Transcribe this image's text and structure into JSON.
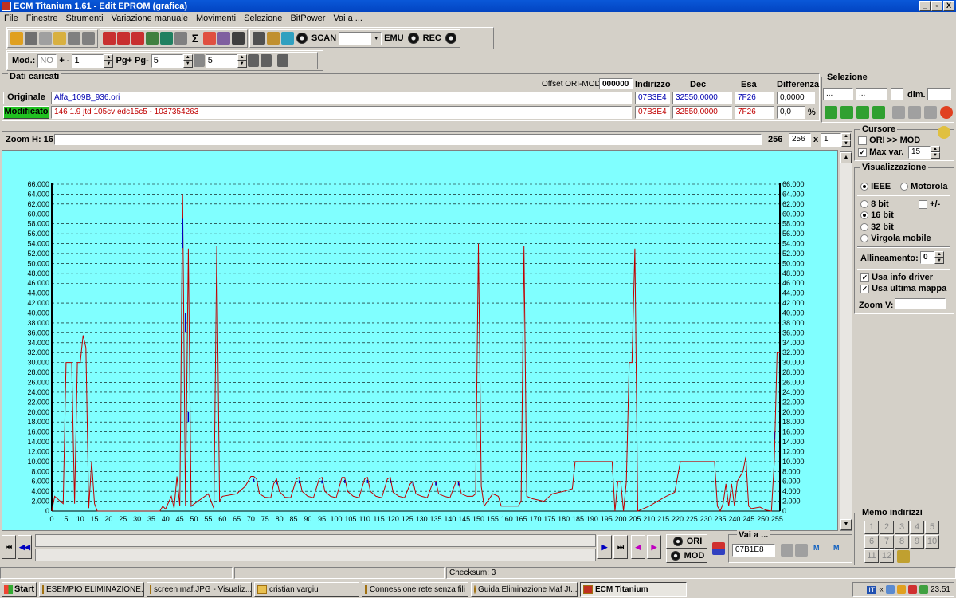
{
  "window": {
    "title": "ECM Titanium 1.61 - Edit EPROM (grafica)",
    "controls": [
      "_",
      "▫",
      "X"
    ]
  },
  "menu": [
    "File",
    "Finestre",
    "Strumenti",
    "Variazione manuale",
    "Movimenti",
    "Selezione",
    "BitPower",
    "Vai a ..."
  ],
  "toolbar": {
    "scan_label": "SCAN",
    "emu_label": "EMU",
    "rec_label": "REC",
    "mod_label": "Mod.:",
    "mod_value": "NO",
    "plusminus_label": "+ -",
    "plusminus_value": "1",
    "pg_label": "Pg+ Pg-",
    "pg_value": "5",
    "p_value": "5"
  },
  "dati": {
    "title": "Dati caricati",
    "offset_label": "Offset ORI-MOD",
    "offset_value": "000000",
    "col_indirizzo": "Indirizzo",
    "col_dec": "Dec",
    "col_esa": "Esa",
    "col_diff": "Differenza",
    "originale_label": "Originale",
    "originale_file": "Alfa_109B_936.ori",
    "originale_addr": "07B3E4",
    "originale_dec": "32550,0000",
    "originale_esa": "7F26",
    "originale_diff": "0,0000",
    "modificato_label": "Modificato",
    "modificato_file": "146 1.9 jtd 105cv edc15c5 - 1037354263",
    "modificato_addr": "07B3E4",
    "modificato_dec": "32550,0000",
    "modificato_esa": "7F26",
    "modificato_diff": "0,0",
    "percent": "%"
  },
  "selezione": {
    "title": "Selezione",
    "f1": "...",
    "f2": "...",
    "dim_label": "dim."
  },
  "zoom": {
    "label": "Zoom H: 16",
    "value_text": "256",
    "value_box": "256",
    "x_label": "x",
    "mult": "1"
  },
  "cursore": {
    "title": "Cursore",
    "ori_mod": "ORI >> MOD",
    "maxvar_label": "Max var.",
    "maxvar_value": "15"
  },
  "visualizzazione": {
    "title": "Visualizzazione",
    "ieee": "IEEE",
    "motorola": "Motorola",
    "bit8": "8 bit",
    "plusminus": "+/-",
    "bit16": "16 bit",
    "bit32": "32 bit",
    "virgola": "Virgola mobile",
    "allineamento_label": "Allineamento:",
    "allineamento_value": "0",
    "usa_info": "Usa info driver",
    "usa_ultima": "Usa ultima mappa",
    "zoomv_label": "Zoom V:"
  },
  "memo": {
    "title": "Memo indirizzi",
    "buttons": [
      "1",
      "2",
      "3",
      "4",
      "5",
      "6",
      "7",
      "8",
      "9",
      "10",
      "11",
      "12"
    ]
  },
  "bottom": {
    "ori_label": "ORI",
    "mod_label": "MOD",
    "vai_label": "Vai a ...",
    "vai_value": "07B1E8"
  },
  "status": {
    "checksum": "Checksum: 3"
  },
  "taskbar": {
    "start": "Start",
    "tasks": [
      "ESEMPIO ELIMINAZIONE...",
      "screen maf.JPG - Visualiz...",
      "cristian vargiu",
      "Connessione rete senza fili",
      "Guida Eliminazione Maf Jt...",
      "ECM Titanium"
    ],
    "clock": "23.51",
    "lang": "IT"
  },
  "colors": {
    "chart_bg": "#80ffff",
    "ori_line": "#c00000",
    "mod_line": "#0000c0",
    "grid": "#000000"
  },
  "chart_data": {
    "type": "line",
    "xlim": [
      0,
      256
    ],
    "ylim": [
      0,
      66000
    ],
    "xticks": [
      0,
      5,
      10,
      15,
      20,
      25,
      30,
      35,
      40,
      45,
      50,
      55,
      60,
      65,
      70,
      75,
      80,
      85,
      90,
      95,
      100,
      105,
      110,
      115,
      120,
      125,
      130,
      135,
      140,
      145,
      150,
      155,
      160,
      165,
      170,
      175,
      180,
      185,
      190,
      195,
      200,
      205,
      210,
      215,
      220,
      225,
      230,
      235,
      240,
      245,
      250,
      255
    ],
    "yticks": [
      "0",
      "2.000",
      "4.000",
      "6.000",
      "8.000",
      "10.000",
      "12.000",
      "14.000",
      "16.000",
      "18.000",
      "20.000",
      "22.000",
      "24.000",
      "26.000",
      "28.000",
      "30.000",
      "32.000",
      "34.000",
      "36.000",
      "38.000",
      "40.000",
      "42.000",
      "44.000",
      "46.000",
      "48.000",
      "50.000",
      "52.000",
      "54.000",
      "56.000",
      "58.000",
      "60.000",
      "62.000",
      "64.000",
      "66.000"
    ],
    "grid": true,
    "series": [
      {
        "points": [
          [
            0,
            0
          ],
          [
            1,
            3000
          ],
          [
            3,
            2000
          ],
          [
            4,
            1500
          ],
          [
            5,
            30000
          ],
          [
            7,
            30000
          ],
          [
            8,
            1500
          ],
          [
            9,
            30000
          ],
          [
            10,
            30000
          ],
          [
            11,
            35500
          ],
          [
            12,
            33000
          ],
          [
            13,
            600
          ],
          [
            14,
            10000
          ],
          [
            15,
            1500
          ],
          [
            16,
            0
          ],
          [
            38,
            0
          ],
          [
            39,
            1000
          ],
          [
            40,
            400
          ],
          [
            42,
            3000
          ],
          [
            43,
            600
          ],
          [
            44,
            7000
          ],
          [
            45,
            1000
          ],
          [
            46,
            64000
          ],
          [
            47,
            1000
          ],
          [
            48,
            53000
          ],
          [
            49,
            1000
          ],
          [
            55,
            3500
          ],
          [
            57,
            500
          ],
          [
            58,
            53500
          ],
          [
            59,
            2000
          ],
          [
            60,
            3000
          ],
          [
            65,
            3500
          ],
          [
            68,
            5000
          ],
          [
            70,
            7000
          ],
          [
            71,
            7000
          ],
          [
            72,
            6500
          ],
          [
            73,
            3500
          ],
          [
            75,
            2800
          ],
          [
            77,
            2700
          ],
          [
            78,
            5500
          ],
          [
            79,
            6500
          ],
          [
            80,
            4000
          ],
          [
            82,
            2800
          ],
          [
            84,
            2700
          ],
          [
            86,
            6500
          ],
          [
            87,
            6800
          ],
          [
            88,
            4000
          ],
          [
            90,
            3000
          ],
          [
            92,
            2700
          ],
          [
            94,
            6500
          ],
          [
            95,
            6800
          ],
          [
            96,
            4000
          ],
          [
            98,
            3000
          ],
          [
            100,
            2700
          ],
          [
            102,
            6800
          ],
          [
            103,
            6800
          ],
          [
            104,
            4000
          ],
          [
            106,
            3000
          ],
          [
            108,
            2700
          ],
          [
            110,
            6500
          ],
          [
            111,
            6800
          ],
          [
            112,
            4000
          ],
          [
            114,
            3000
          ],
          [
            116,
            2700
          ],
          [
            118,
            6500
          ],
          [
            119,
            6800
          ],
          [
            120,
            3800
          ],
          [
            122,
            3000
          ],
          [
            124,
            2700
          ],
          [
            126,
            5500
          ],
          [
            127,
            6000
          ],
          [
            128,
            3500
          ],
          [
            130,
            3000
          ],
          [
            132,
            2700
          ],
          [
            134,
            5800
          ],
          [
            135,
            6000
          ],
          [
            136,
            3500
          ],
          [
            138,
            3000
          ],
          [
            140,
            2700
          ],
          [
            142,
            5800
          ],
          [
            143,
            6000
          ],
          [
            144,
            3500
          ],
          [
            146,
            3000
          ],
          [
            148,
            3000
          ],
          [
            149,
            3500
          ],
          [
            150,
            54000
          ],
          [
            151,
            5000
          ],
          [
            152,
            1000
          ],
          [
            155,
            3500
          ],
          [
            157,
            3000
          ],
          [
            158,
            1000
          ],
          [
            164,
            1000
          ],
          [
            165,
            2000
          ],
          [
            166,
            53500
          ],
          [
            167,
            3000
          ],
          [
            169,
            2500
          ],
          [
            173,
            2000
          ],
          [
            176,
            3500
          ],
          [
            180,
            4000
          ],
          [
            183,
            4500
          ],
          [
            184,
            10000
          ],
          [
            197,
            10000
          ],
          [
            198,
            0
          ],
          [
            199,
            6000
          ],
          [
            200,
            6000
          ],
          [
            201,
            0
          ],
          [
            202,
            6000
          ],
          [
            203,
            30000
          ],
          [
            204,
            30000
          ],
          [
            205,
            53000
          ],
          [
            206,
            0
          ],
          [
            210,
            1000
          ],
          [
            213,
            2000
          ],
          [
            216,
            3000
          ],
          [
            219,
            3800
          ],
          [
            221,
            10000
          ],
          [
            233,
            10000
          ],
          [
            234,
            1000
          ],
          [
            235,
            0
          ],
          [
            236,
            1500
          ],
          [
            237,
            5500
          ],
          [
            238,
            1000
          ],
          [
            239,
            5500
          ],
          [
            240,
            1000
          ],
          [
            241,
            6000
          ],
          [
            243,
            8000
          ],
          [
            244,
            11000
          ],
          [
            245,
            1000
          ],
          [
            246,
            500
          ],
          [
            249,
            800
          ],
          [
            251,
            200
          ],
          [
            253,
            0
          ],
          [
            254,
            10000
          ],
          [
            255,
            32000
          ],
          [
            256,
            32000
          ]
        ]
      },
      {
        "points": [
          [
            44,
            2000
          ],
          [
            46,
            59000
          ],
          [
            47,
            40000
          ],
          [
            48,
            20000
          ],
          [
            49,
            1000
          ],
          [
            71,
            6500
          ],
          [
            79,
            6000
          ],
          [
            87,
            6200
          ],
          [
            95,
            6200
          ],
          [
            103,
            6300
          ],
          [
            111,
            6300
          ],
          [
            119,
            6300
          ],
          [
            127,
            5800
          ],
          [
            135,
            5800
          ],
          [
            143,
            5800
          ],
          [
            254,
            16000
          ]
        ]
      }
    ]
  }
}
